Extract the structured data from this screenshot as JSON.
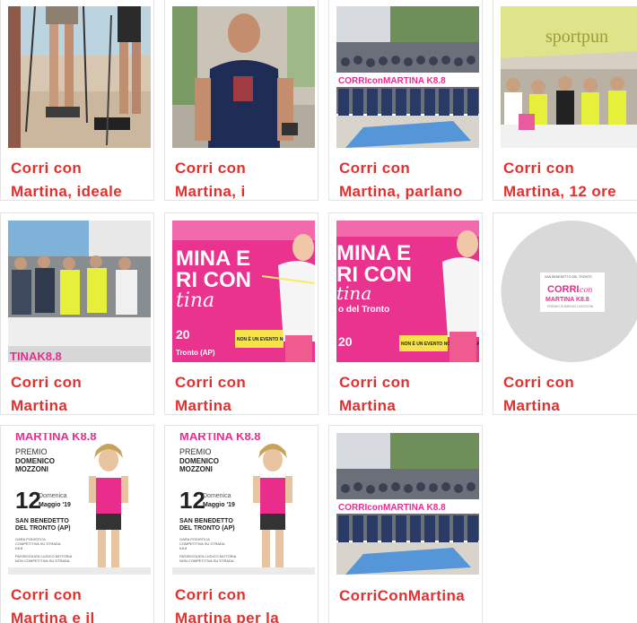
{
  "colors": {
    "title_red": "#e2302f",
    "card_border": "#e4e4e4",
    "magenta": "#ea2d8c"
  },
  "posts": [
    {
      "title_line1": "Corri con",
      "title_line2": "Martina, ideale",
      "image_icon": "running-legs-photo"
    },
    {
      "title_line1": "Corri con",
      "title_line2": "Martina, i",
      "image_icon": "runner-portrait-photo"
    },
    {
      "title_line1": "Corri con",
      "title_line2": "Martina, parlano",
      "image_icon": "race-start-crowd-photo"
    },
    {
      "title_line1": "Corri con",
      "title_line2": "Martina, 12 ore",
      "image_icon": "volunteers-tent-photo"
    },
    {
      "title_line1": "Corri con",
      "title_line2": "Martina",
      "image_icon": "volunteers-table-photo"
    },
    {
      "title_line1": "Corri con",
      "title_line2": "Martina",
      "image_icon": "event-poster-pink"
    },
    {
      "title_line1": "Corri con",
      "title_line2": "Martina",
      "image_icon": "event-poster-pink"
    },
    {
      "title_line1": "Corri con",
      "title_line2": "Martina",
      "image_icon": "logo-placeholder-circle"
    },
    {
      "title_line1": "Corri con",
      "title_line2": "Martina e il",
      "image_icon": "premio-poster"
    },
    {
      "title_line1": "Corri con",
      "title_line2": "Martina per la",
      "image_icon": "premio-poster"
    },
    {
      "title_line1": "CorriConMartina",
      "title_line2": "",
      "image_icon": "race-start-crowd-photo"
    }
  ],
  "poster": {
    "headline_1": "MINA E",
    "headline_2": "RI CON",
    "script": "tina",
    "location": "o del Tronto",
    "badge": "NON È UN EVENTO NON È UNA GARA",
    "year_fragment": "20",
    "place": "Tronto (AP)"
  },
  "banner": {
    "brand_top": "CORRI",
    "brand_con": "con",
    "brand_bottom": "MARTINA K8.8",
    "crowd_banner": "CORRIconMARTINA K8.8"
  },
  "logo_card": {
    "caption_top": "SAN BENEDETTO DEL TRONTO",
    "brand": "CORRI",
    "brand_con": "con",
    "brand_name": "MARTINA K8.8",
    "tagline": "PREMIO DOMENICO MOZZONI"
  },
  "premio": {
    "top_band": "MARTINA K8.8",
    "label": "PREMIO",
    "name_1": "DOMENICO",
    "name_2": "MOZZONI",
    "day": "12",
    "weekday": "Domenica",
    "month": "Maggio '19",
    "city_1": "SAN BENEDETTO",
    "city_2": "DEL TRONTO (AP)",
    "race_1": "GARA PODISTICA",
    "race_2": "COMPETITIVA SU STRADA",
    "race_3": "K8.8",
    "walk_1": "PASSEGGIATA LUDICO MOTORIA",
    "walk_2": "NON COMPETITIVA SU STRADA"
  },
  "tent": {
    "sign": "sportpun"
  }
}
